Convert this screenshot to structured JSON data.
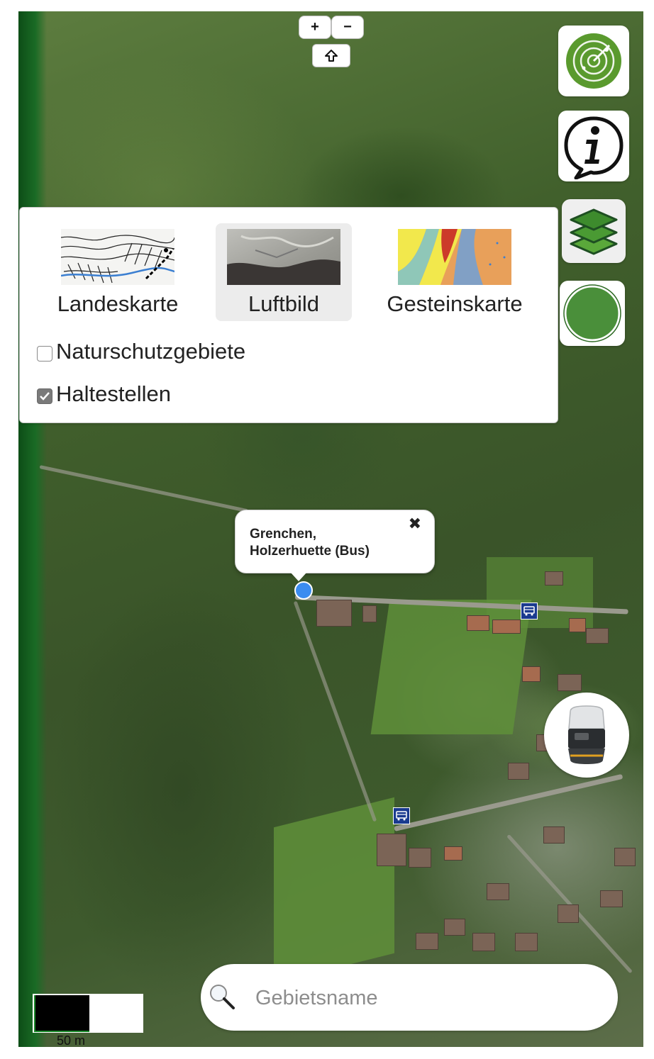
{
  "map": {
    "zoom_in_label": "+",
    "zoom_out_label": "−",
    "scale_label": "50 m"
  },
  "layers": {
    "base_maps": [
      {
        "label": "Landeskarte",
        "selected": false
      },
      {
        "label": "Luftbild",
        "selected": true
      },
      {
        "label": "Gesteinskarte",
        "selected": false
      }
    ],
    "overlays": [
      {
        "label": "Naturschutzgebiete",
        "checked": false
      },
      {
        "label": "Haltestellen",
        "checked": true
      }
    ]
  },
  "popup": {
    "title": "Grenchen,\nHolzerhuette (Bus)",
    "close_symbol": "✖"
  },
  "search": {
    "placeholder": "Gebietsname"
  },
  "colors": {
    "radar_green": "#5a9a2e",
    "location_green": "#4a8f3a",
    "marker_blue": "#3b8cf0",
    "bus_stop_blue": "#1a3a8f"
  }
}
